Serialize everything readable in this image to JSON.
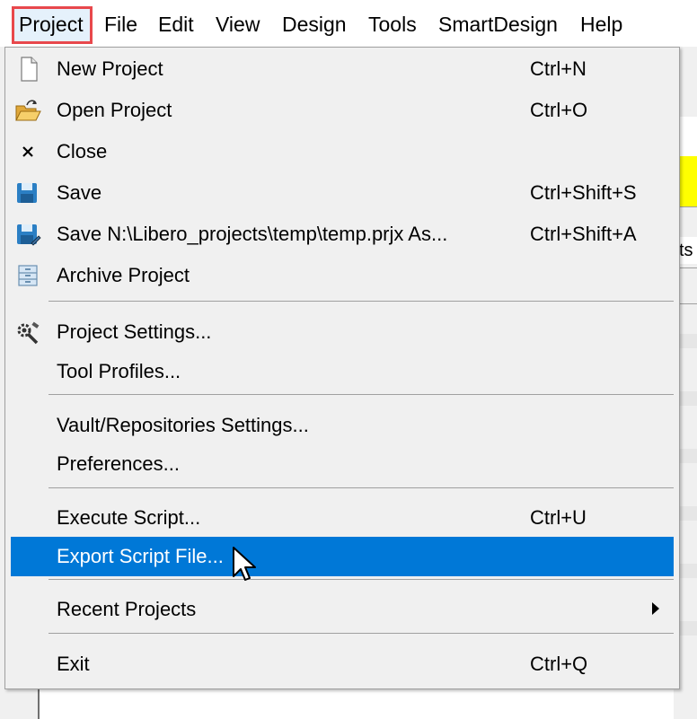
{
  "menubar": {
    "items": [
      "Project",
      "File",
      "Edit",
      "View",
      "Design",
      "Tools",
      "SmartDesign",
      "Help"
    ]
  },
  "background": {
    "right_fragment_text": "ts"
  },
  "menu": {
    "items": [
      {
        "label": "New Project",
        "shortcut": "Ctrl+N",
        "icon": "new-file-icon"
      },
      {
        "label": "Open Project",
        "shortcut": "Ctrl+O",
        "icon": "open-folder-icon"
      },
      {
        "label": "Close",
        "shortcut": "",
        "icon": "close-icon"
      },
      {
        "label": "Save",
        "shortcut": "Ctrl+Shift+S",
        "icon": "save-icon"
      },
      {
        "label": "Save N:\\Libero_projects\\temp\\temp.prjx As...",
        "shortcut": "Ctrl+Shift+A",
        "icon": "save-as-icon"
      },
      {
        "label": "Archive Project",
        "shortcut": "",
        "icon": "archive-icon"
      },
      {
        "label": "Project Settings...",
        "shortcut": "",
        "icon": "settings-wrench-icon"
      },
      {
        "label": "Tool Profiles...",
        "shortcut": ""
      },
      {
        "label": "Vault/Repositories Settings...",
        "shortcut": ""
      },
      {
        "label": "Preferences...",
        "shortcut": ""
      },
      {
        "label": "Execute Script...",
        "shortcut": "Ctrl+U"
      },
      {
        "label": "Export Script File...",
        "shortcut": "",
        "selected": true
      },
      {
        "label": "Recent Projects",
        "shortcut": "",
        "submenu": true
      },
      {
        "label": "Exit",
        "shortcut": "Ctrl+Q"
      }
    ]
  },
  "colors": {
    "selection": "#0078d7",
    "menubar_highlight_border": "#e8484c",
    "menu_background": "#f0f0f0"
  }
}
